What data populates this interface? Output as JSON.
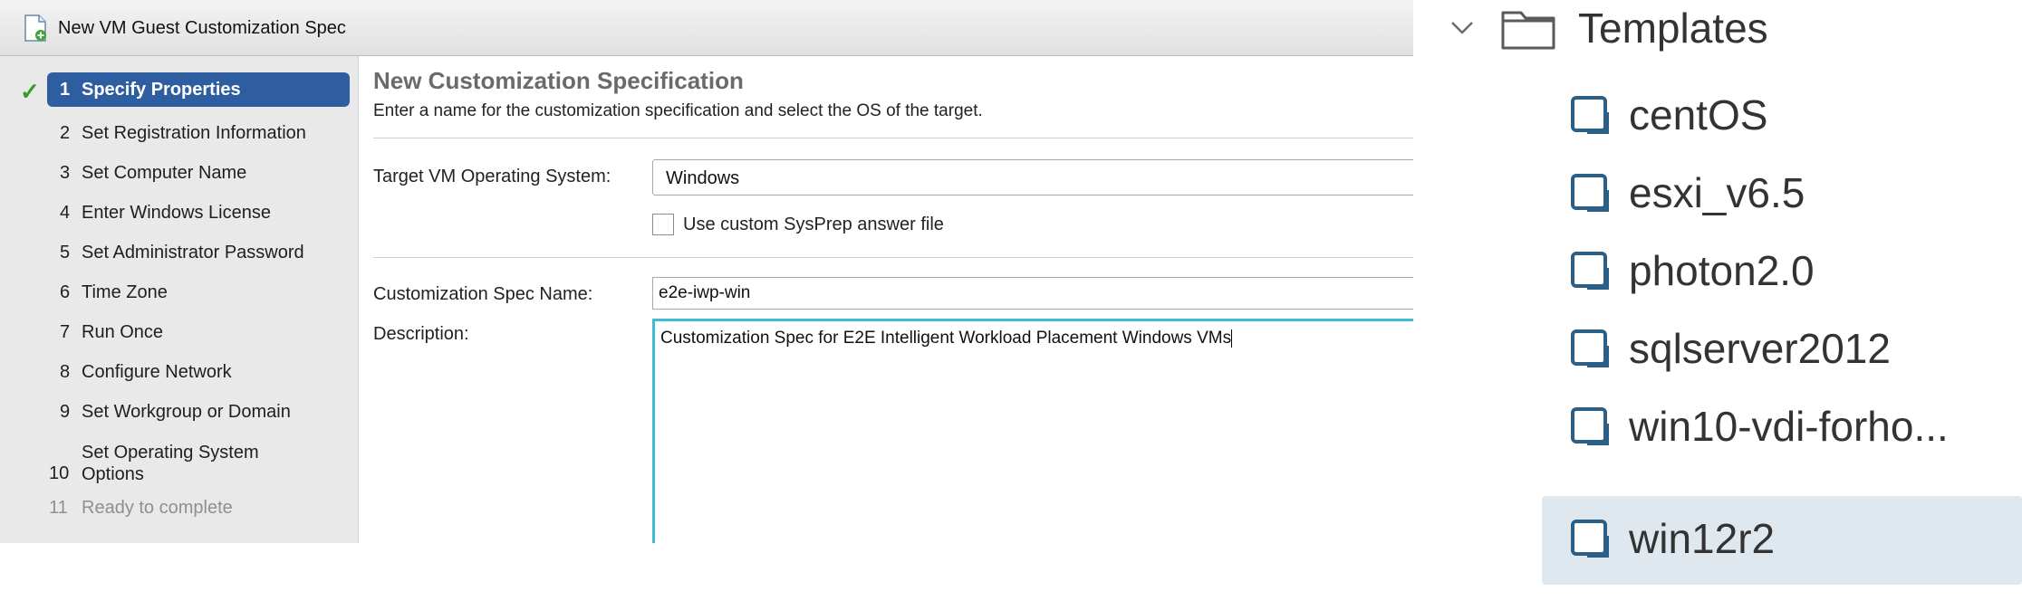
{
  "wizard": {
    "title": "New VM Guest Customization Spec",
    "steps": [
      {
        "num": "1",
        "label": "Specify Properties"
      },
      {
        "num": "2",
        "label": "Set Registration Information"
      },
      {
        "num": "3",
        "label": "Set Computer Name"
      },
      {
        "num": "4",
        "label": "Enter Windows License"
      },
      {
        "num": "5",
        "label": "Set Administrator Password"
      },
      {
        "num": "6",
        "label": "Time Zone"
      },
      {
        "num": "7",
        "label": "Run Once"
      },
      {
        "num": "8",
        "label": "Configure Network"
      },
      {
        "num": "9",
        "label": "Set Workgroup or Domain"
      },
      {
        "num": "10",
        "label": "Set Operating System Options"
      },
      {
        "num": "11",
        "label": "Ready to complete"
      }
    ],
    "content": {
      "heading": "New Customization Specification",
      "subheading": "Enter a name for the customization specification and select the OS of the target.",
      "target_os_label": "Target VM Operating System:",
      "target_os_value": "Windows",
      "sysprep_label": "Use custom SysPrep answer file",
      "sysprep_checked": false,
      "spec_name_label": "Customization Spec Name:",
      "spec_name_value": "e2e-iwp-win",
      "description_label": "Description:",
      "description_value": "Customization Spec for E2E Intelligent Workload Placement Windows VMs"
    }
  },
  "tree": {
    "folder": {
      "label": "Templates",
      "icon": "folder-icon",
      "expand_icon": "chevron-down-icon"
    },
    "items": [
      {
        "label": "centOS",
        "icon": "vm-template-icon"
      },
      {
        "label": "esxi_v6.5",
        "icon": "vm-template-icon"
      },
      {
        "label": "photon2.0",
        "icon": "vm-template-icon"
      },
      {
        "label": "sqlserver2012",
        "icon": "vm-template-icon"
      },
      {
        "label": "win10-vdi-forho...",
        "icon": "vm-template-icon"
      },
      {
        "label": "win12r2",
        "icon": "vm-template-icon",
        "selected": true
      }
    ]
  },
  "colors": {
    "active_step_bg": "#2f5ea0",
    "check_green": "#3a9a2a",
    "textarea_focus": "#3fbcd4",
    "tree_selected_bg": "#dfe8ef"
  }
}
